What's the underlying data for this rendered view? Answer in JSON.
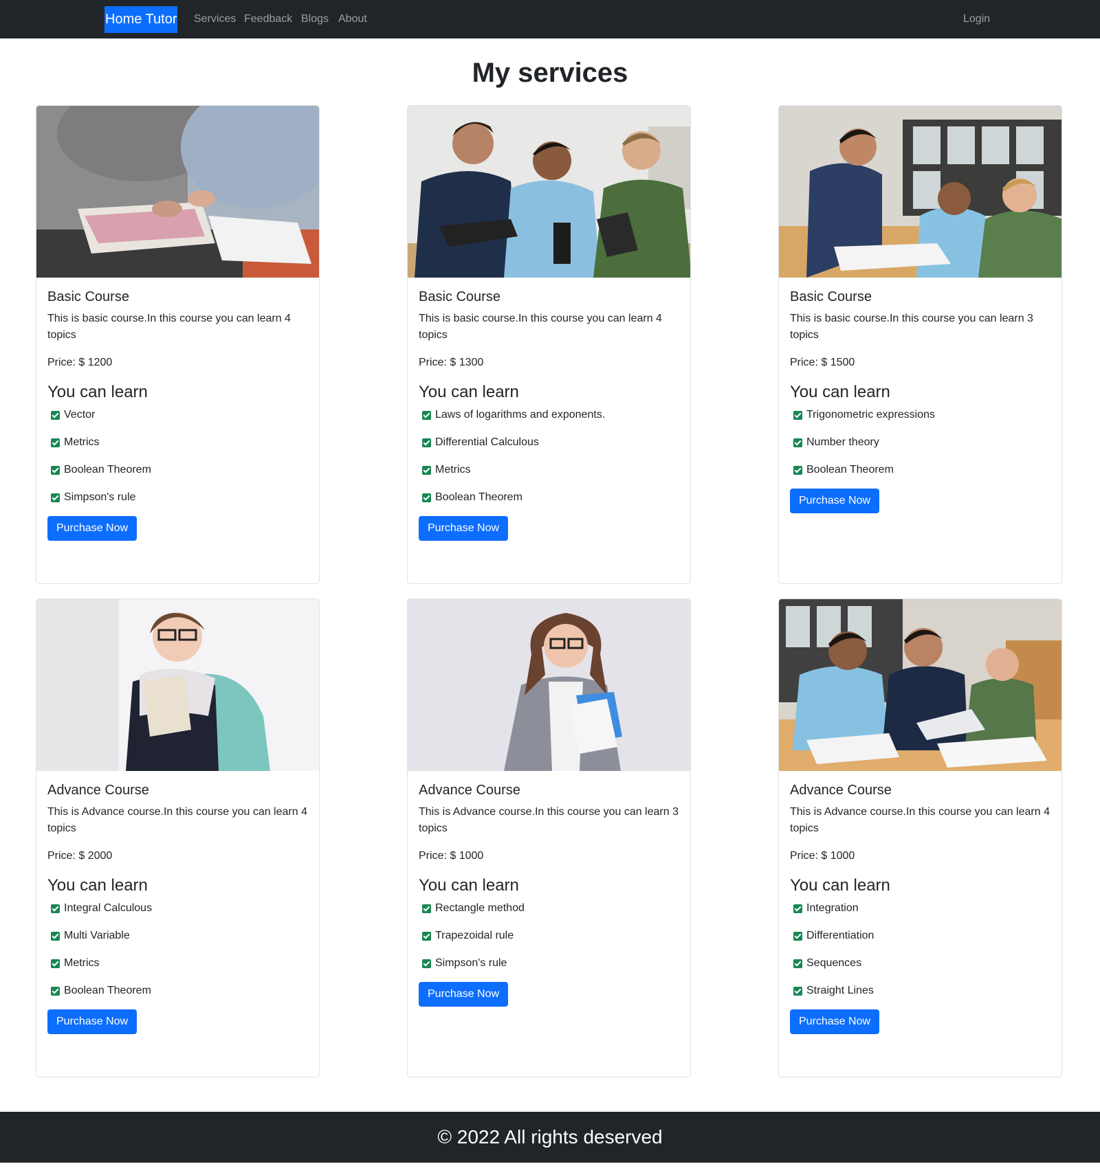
{
  "navbar": {
    "brand": "Home Tutor",
    "links": [
      "Services",
      "Feedback",
      "Blogs",
      "About"
    ],
    "login": "Login"
  },
  "page": {
    "title": "My services"
  },
  "cards": [
    {
      "title": "Basic Course",
      "description": "This is basic course.In this course you can learn 4 topics",
      "price": "Price: $ 1200",
      "learn_heading": "You can learn",
      "topics": [
        "Vector",
        "Metrics",
        "Boolean Theorem",
        "Simpson's rule"
      ],
      "button": "Purchase Now",
      "image": "tutor-with-notebooks-photo"
    },
    {
      "title": "Basic Course",
      "description": "This is basic course.In this course you can learn 4 topics",
      "price": "Price: $ 1300",
      "learn_heading": "You can learn",
      "topics": [
        "Laws of logarithms and exponents.",
        "Differential Calculous",
        "Metrics",
        "Boolean Theorem"
      ],
      "button": "Purchase Now",
      "image": "three-students-standing-photo"
    },
    {
      "title": "Basic Course",
      "description": "This is basic course.In this course you can learn 3 topics",
      "price": "Price: $ 1500",
      "learn_heading": "You can learn",
      "topics": [
        "Trigonometric expressions",
        "Number theory",
        "Boolean Theorem"
      ],
      "button": "Purchase Now",
      "image": "students-at-table-photo"
    },
    {
      "title": "Advance Course",
      "description": "This is Advance course.In this course you can learn 4 topics",
      "price": "Price: $ 2000",
      "learn_heading": "You can learn",
      "topics": [
        "Integral Calculous",
        "Multi Variable",
        "Metrics",
        "Boolean Theorem"
      ],
      "button": "Purchase Now",
      "image": "girl-with-backpack-photo"
    },
    {
      "title": "Advance Course",
      "description": "This is Advance course.In this course you can learn 3 topics",
      "price": "Price: $ 1000",
      "learn_heading": "You can learn",
      "topics": [
        "Rectangle method",
        "Trapezoidal rule",
        "Simpson's rule"
      ],
      "button": "Purchase Now",
      "image": "woman-holding-books-photo"
    },
    {
      "title": "Advance Course",
      "description": "This is Advance course.In this course you can learn 4 topics",
      "price": "Price: $ 1000",
      "learn_heading": "You can learn",
      "topics": [
        "Integration",
        "Differentiation",
        "Sequences",
        "Straight Lines"
      ],
      "button": "Purchase Now",
      "image": "students-with-tablet-photo"
    }
  ],
  "footer": {
    "text": "© 2022 All rights deserved"
  },
  "colors": {
    "navbar": "#212529",
    "primary": "#0d6efd",
    "check": "#198754"
  }
}
